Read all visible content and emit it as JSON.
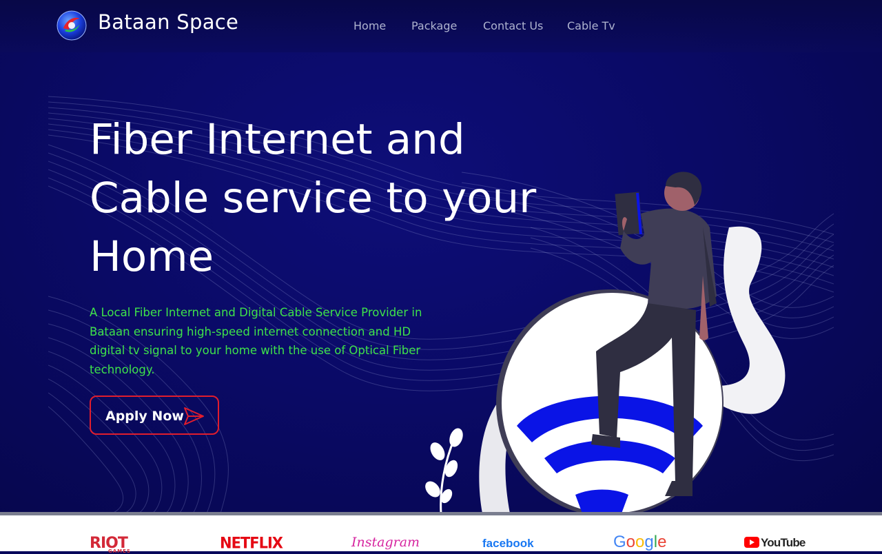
{
  "header": {
    "brand_name": "Bataan Space",
    "logo_icon": "globe-logo-icon",
    "nav": [
      {
        "label": "Home"
      },
      {
        "label": "Package"
      },
      {
        "label": "Contact Us"
      },
      {
        "label": "Cable Tv"
      }
    ]
  },
  "hero": {
    "title_lines": [
      "Fiber Internet and",
      "Cable service to your",
      "Home"
    ],
    "description": "A Local Fiber Internet and Digital Cable Service Provider in Bataan ensuring high-speed internet connection and HD digital tv signal to your home with the use of Optical Fiber technology.",
    "cta_label": "Apply Now",
    "cta_icon": "paper-plane-icon",
    "illustration": "person-on-wifi-router-illustration"
  },
  "partners": {
    "riot": {
      "main": "RIOT",
      "sub": "GAMES"
    },
    "netflix": "NETFLIX",
    "instagram": "Instagram",
    "facebook": "facebook",
    "google": [
      "G",
      "o",
      "o",
      "g",
      "l",
      "e"
    ],
    "youtube": "YouTube"
  },
  "colors": {
    "background": "#0a0a66",
    "accent_green": "#3ee24a",
    "cta_border": "#e11d2d",
    "wifi_blue": "#0a14e6"
  }
}
